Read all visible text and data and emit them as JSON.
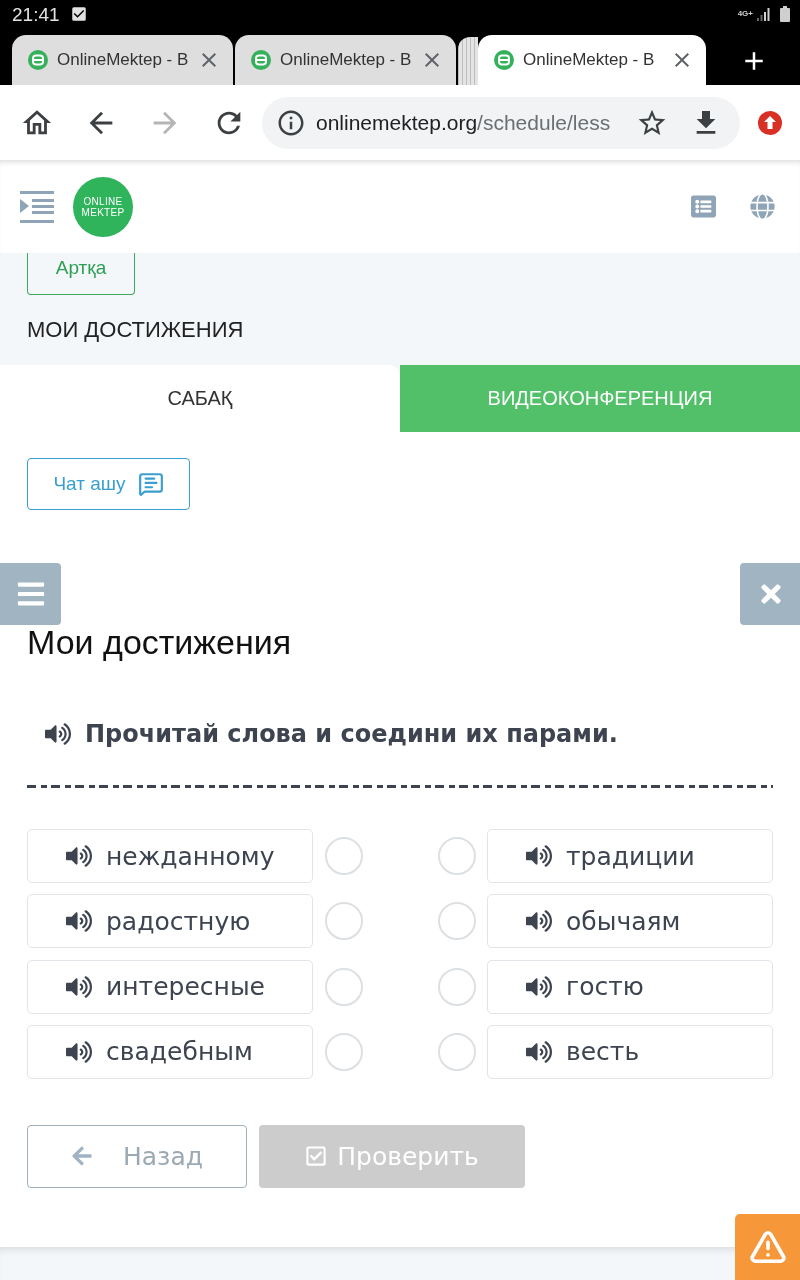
{
  "status_bar": {
    "time": "21:41",
    "network": "4G+"
  },
  "browser_tabs": [
    {
      "title": "OnlineMektep - B",
      "selected": false
    },
    {
      "title": "OnlineMektep - B",
      "selected": false
    },
    {
      "title": "OnlineMektep - B",
      "selected": true
    }
  ],
  "nav_buttons": [
    {
      "kind": "home",
      "disabled": false
    },
    {
      "kind": "back",
      "disabled": false
    },
    {
      "kind": "forward",
      "disabled": true
    },
    {
      "kind": "reload",
      "disabled": false
    }
  ],
  "address_bar": {
    "domain": "onlinemektep.org",
    "path": "/schedule/less"
  },
  "site_header": {
    "logo": [
      "ONLINE",
      "MEKTEP"
    ]
  },
  "back_link": "Артқа",
  "section_title": "МОИ ДОСТИЖЕНИЯ",
  "lesson_tabs": [
    {
      "label": "САБАҚ",
      "selected": true
    },
    {
      "label": "ВИДЕОКОНФЕРЕНЦИЯ",
      "selected": false
    }
  ],
  "chat_button": "Чат ашу",
  "exercise": {
    "title": "Мои достижения",
    "instruction": "Прочитай слова и соедини их парами.",
    "left": [
      {
        "word": "нежданному",
        "selected": false
      },
      {
        "word": "радостную",
        "selected": false
      },
      {
        "word": "интересные",
        "selected": false
      },
      {
        "word": "свадебным",
        "selected": false
      }
    ],
    "right": [
      {
        "word": "традиции",
        "selected": false
      },
      {
        "word": "обычаям",
        "selected": false
      },
      {
        "word": "гостю",
        "selected": false
      },
      {
        "word": "весть",
        "selected": false
      }
    ]
  },
  "buttons": [
    {
      "kind": "back",
      "label": "Назад",
      "disabled": false
    },
    {
      "kind": "check",
      "label": "Проверить",
      "disabled": true
    }
  ]
}
